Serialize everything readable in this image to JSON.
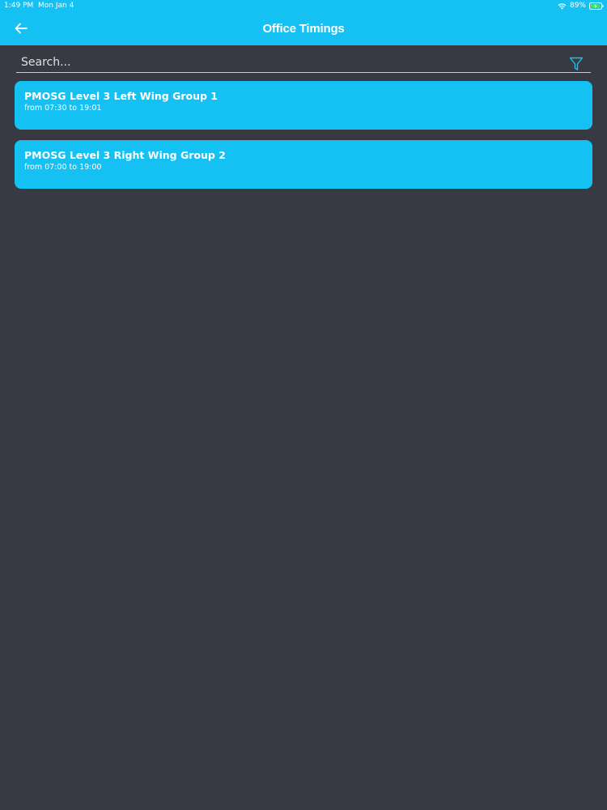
{
  "status_bar": {
    "time": "1:49 PM",
    "date": "Mon Jan 4",
    "battery": "89%",
    "wifi_icon": "wifi-icon",
    "battery_icon": "battery-charging-icon"
  },
  "header": {
    "title": "Office Timings",
    "back_icon": "arrow-left-icon"
  },
  "search": {
    "placeholder": "Search...",
    "value": "",
    "filter_icon": "filter-icon"
  },
  "timings": [
    {
      "name": "PMOSG Level 3 Left Wing Group 1",
      "schedule": "from 07:30 to 19:01"
    },
    {
      "name": "PMOSG Level 3 Right Wing Group 2",
      "schedule": "from 07:00 to 19:00"
    }
  ],
  "colors": {
    "accent": "#15c1f3",
    "background": "#373a42",
    "text": "#ffffff"
  }
}
